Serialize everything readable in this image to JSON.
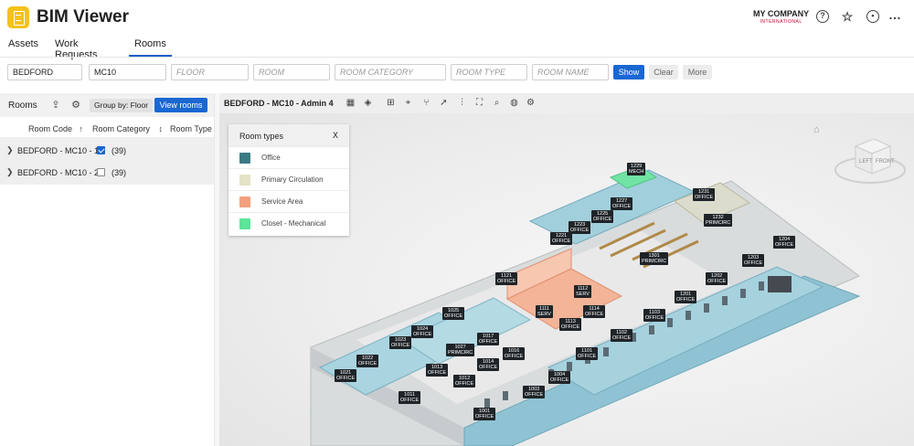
{
  "app": {
    "title": "BIM Viewer",
    "company": "MY COMPANY",
    "company_sub": "INTERNATIONAL"
  },
  "header_icons": [
    "help-icon",
    "favorite-settings-icon",
    "user-icon",
    "more-icon"
  ],
  "tabs": [
    {
      "label": "Assets"
    },
    {
      "label": "Work Requests"
    },
    {
      "label": "Rooms",
      "active": true
    }
  ],
  "filters": {
    "site": "BEDFORD",
    "building": "MC10",
    "floor_placeholder": "FLOOR",
    "room_placeholder": "ROOM",
    "category_placeholder": "ROOM CATEGORY",
    "type_placeholder": "ROOM TYPE",
    "name_placeholder": "ROOM NAME",
    "show_label": "Show",
    "clear_label": "Clear",
    "more_label": "More"
  },
  "rooms_panel": {
    "title": "Rooms",
    "group_by": "Group by: Floor",
    "view_rooms": "View rooms",
    "columns": [
      "Room Code",
      "Room Category",
      "Room Type"
    ],
    "sort_asc": "↑",
    "sort_toggle": "↕",
    "rows": [
      {
        "label": "BEDFORD - MC10 - 1",
        "checked": true,
        "count": "(39)"
      },
      {
        "label": "BEDFORD - MC10 - 2",
        "checked": false,
        "count": "(39)"
      }
    ]
  },
  "viewer": {
    "title": "BEDFORD - MC10 - Admin 4",
    "legend": {
      "title": "Room types",
      "close": "X",
      "items": [
        {
          "label": "Office",
          "color": "#3c7a83"
        },
        {
          "label": "Primary Circulation",
          "color": "#e4e2c6"
        },
        {
          "label": "Service Area",
          "color": "#f2a07e"
        },
        {
          "label": "Closet - Mechanical",
          "color": "#5ee39a"
        }
      ]
    },
    "nav_cube": {
      "left": "LEFT",
      "front": "FRONT"
    },
    "room_labels": [
      {
        "code": "1229",
        "type": "MECH"
      },
      {
        "code": "1231",
        "type": "OFFICE"
      },
      {
        "code": "1227",
        "type": "OFFICE"
      },
      {
        "code": "1225",
        "type": "OFFICE"
      },
      {
        "code": "1223",
        "type": "OFFICE"
      },
      {
        "code": "1232",
        "type": "PRIMCIRC"
      },
      {
        "code": "1221",
        "type": "OFFICE"
      },
      {
        "code": "1204",
        "type": "OFFICE"
      },
      {
        "code": "1301",
        "type": "PRIMCIRC"
      },
      {
        "code": "1203",
        "type": "OFFICE"
      },
      {
        "code": "1121",
        "type": "OFFICE"
      },
      {
        "code": "1202",
        "type": "OFFICE"
      },
      {
        "code": "1112",
        "type": "SERV"
      },
      {
        "code": "1201",
        "type": "OFFICE"
      },
      {
        "code": "1025",
        "type": "OFFICE"
      },
      {
        "code": "1111",
        "type": "SERV"
      },
      {
        "code": "1114",
        "type": "OFFICE"
      },
      {
        "code": "1103",
        "type": "OFFICE"
      },
      {
        "code": "1024",
        "type": "OFFICE"
      },
      {
        "code": "1113",
        "type": "OFFICE"
      },
      {
        "code": "1017",
        "type": "OFFICE"
      },
      {
        "code": "1023",
        "type": "OFFICE"
      },
      {
        "code": "1102",
        "type": "OFFICE"
      },
      {
        "code": "1027",
        "type": "PRIMCIRC"
      },
      {
        "code": "1016",
        "type": "OFFICE"
      },
      {
        "code": "1101",
        "type": "OFFICE"
      },
      {
        "code": "1022",
        "type": "OFFICE"
      },
      {
        "code": "1014",
        "type": "OFFICE"
      },
      {
        "code": "1013",
        "type": "OFFICE"
      },
      {
        "code": "1021",
        "type": "OFFICE"
      },
      {
        "code": "1004",
        "type": "OFFICE"
      },
      {
        "code": "1012",
        "type": "OFFICE"
      },
      {
        "code": "1003",
        "type": "OFFICE"
      },
      {
        "code": "1011",
        "type": "OFFICE"
      },
      {
        "code": "1001",
        "type": "OFFICE"
      }
    ]
  }
}
